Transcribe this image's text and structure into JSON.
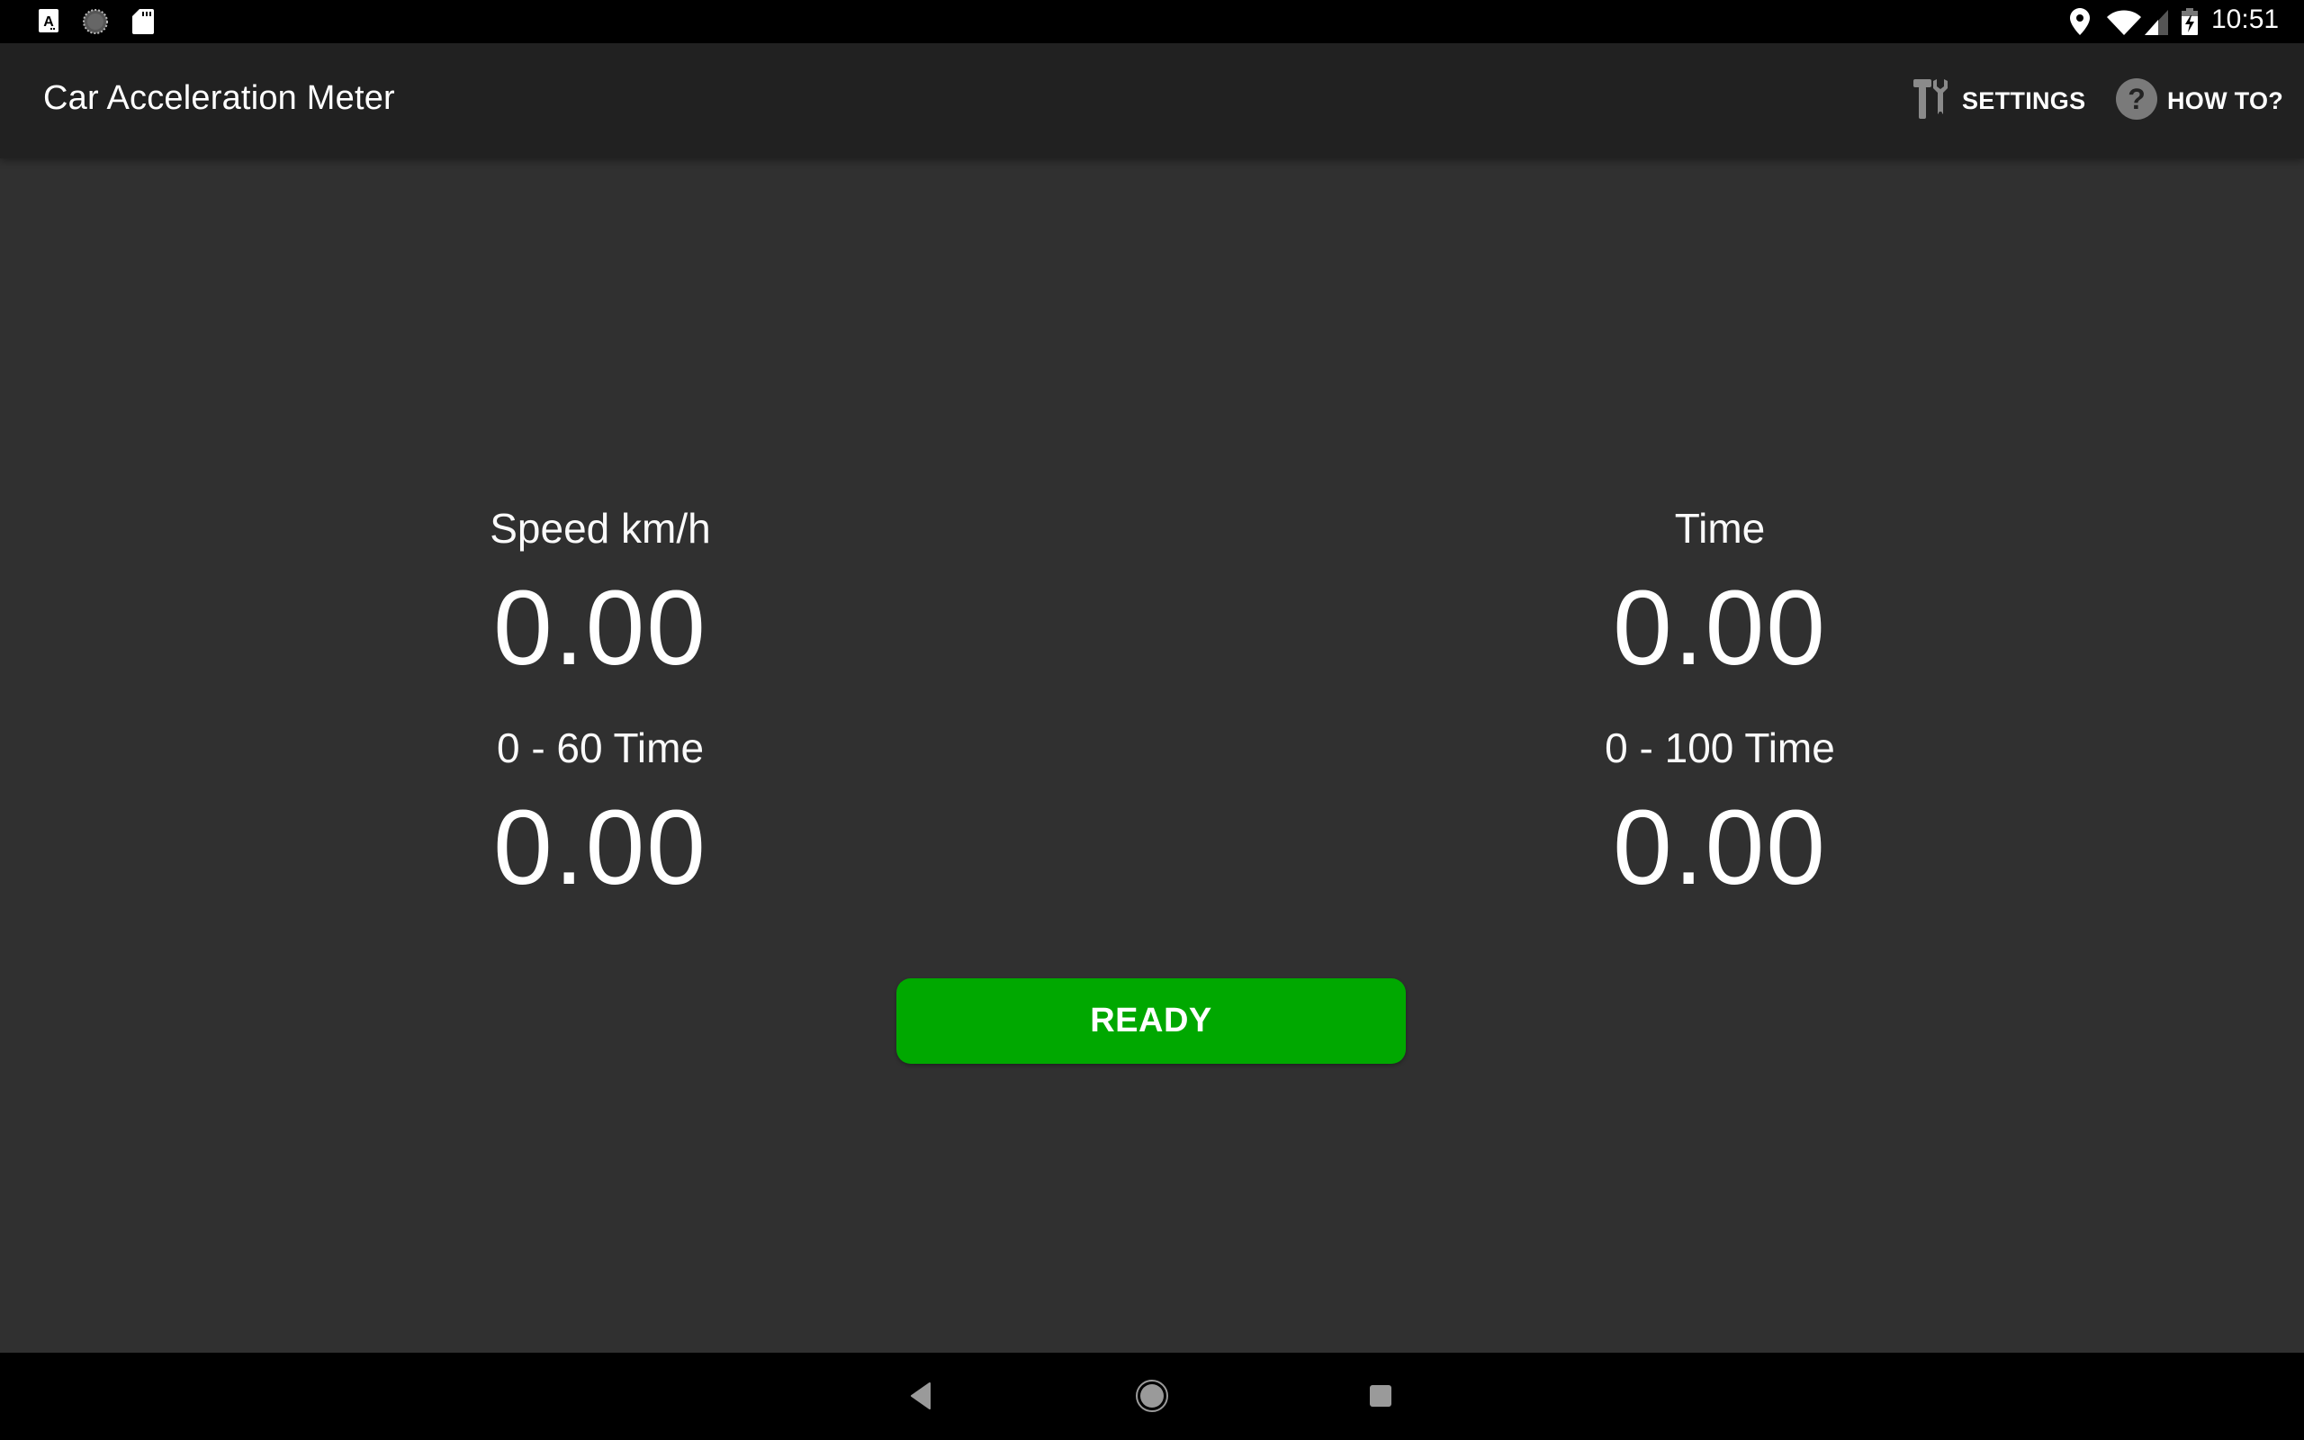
{
  "status_bar": {
    "left_icons": [
      "text-a-notification-icon",
      "sync-circle-notification-icon",
      "sd-card-icon"
    ],
    "right_icons": [
      "location-pin-icon",
      "wifi-icon",
      "cell-signal-icon",
      "battery-charging-icon"
    ],
    "time": "10:51"
  },
  "app_bar": {
    "title": "Car Acceleration Meter",
    "actions": [
      {
        "icon": "tools-icon",
        "label": "SETTINGS"
      },
      {
        "icon": "help-circle-icon",
        "label": "HOW TO?"
      }
    ]
  },
  "meter": {
    "speed": {
      "label": "Speed km/h",
      "value": "0.00"
    },
    "time": {
      "label": "Time",
      "value": "0.00"
    },
    "zero_to_60": {
      "label": "0 - 60 Time",
      "value": "0.00"
    },
    "zero_to_100": {
      "label": "0 - 100 Time",
      "value": "0.00"
    }
  },
  "ready_button": {
    "label": "READY",
    "color": "#00a800"
  },
  "nav_bar": {
    "buttons": [
      "back-icon",
      "home-icon",
      "recents-icon"
    ]
  },
  "colors": {
    "status_bar_bg": "#000000",
    "app_bar_bg": "#212121",
    "content_bg": "#303030",
    "accent_green": "#00a800"
  }
}
